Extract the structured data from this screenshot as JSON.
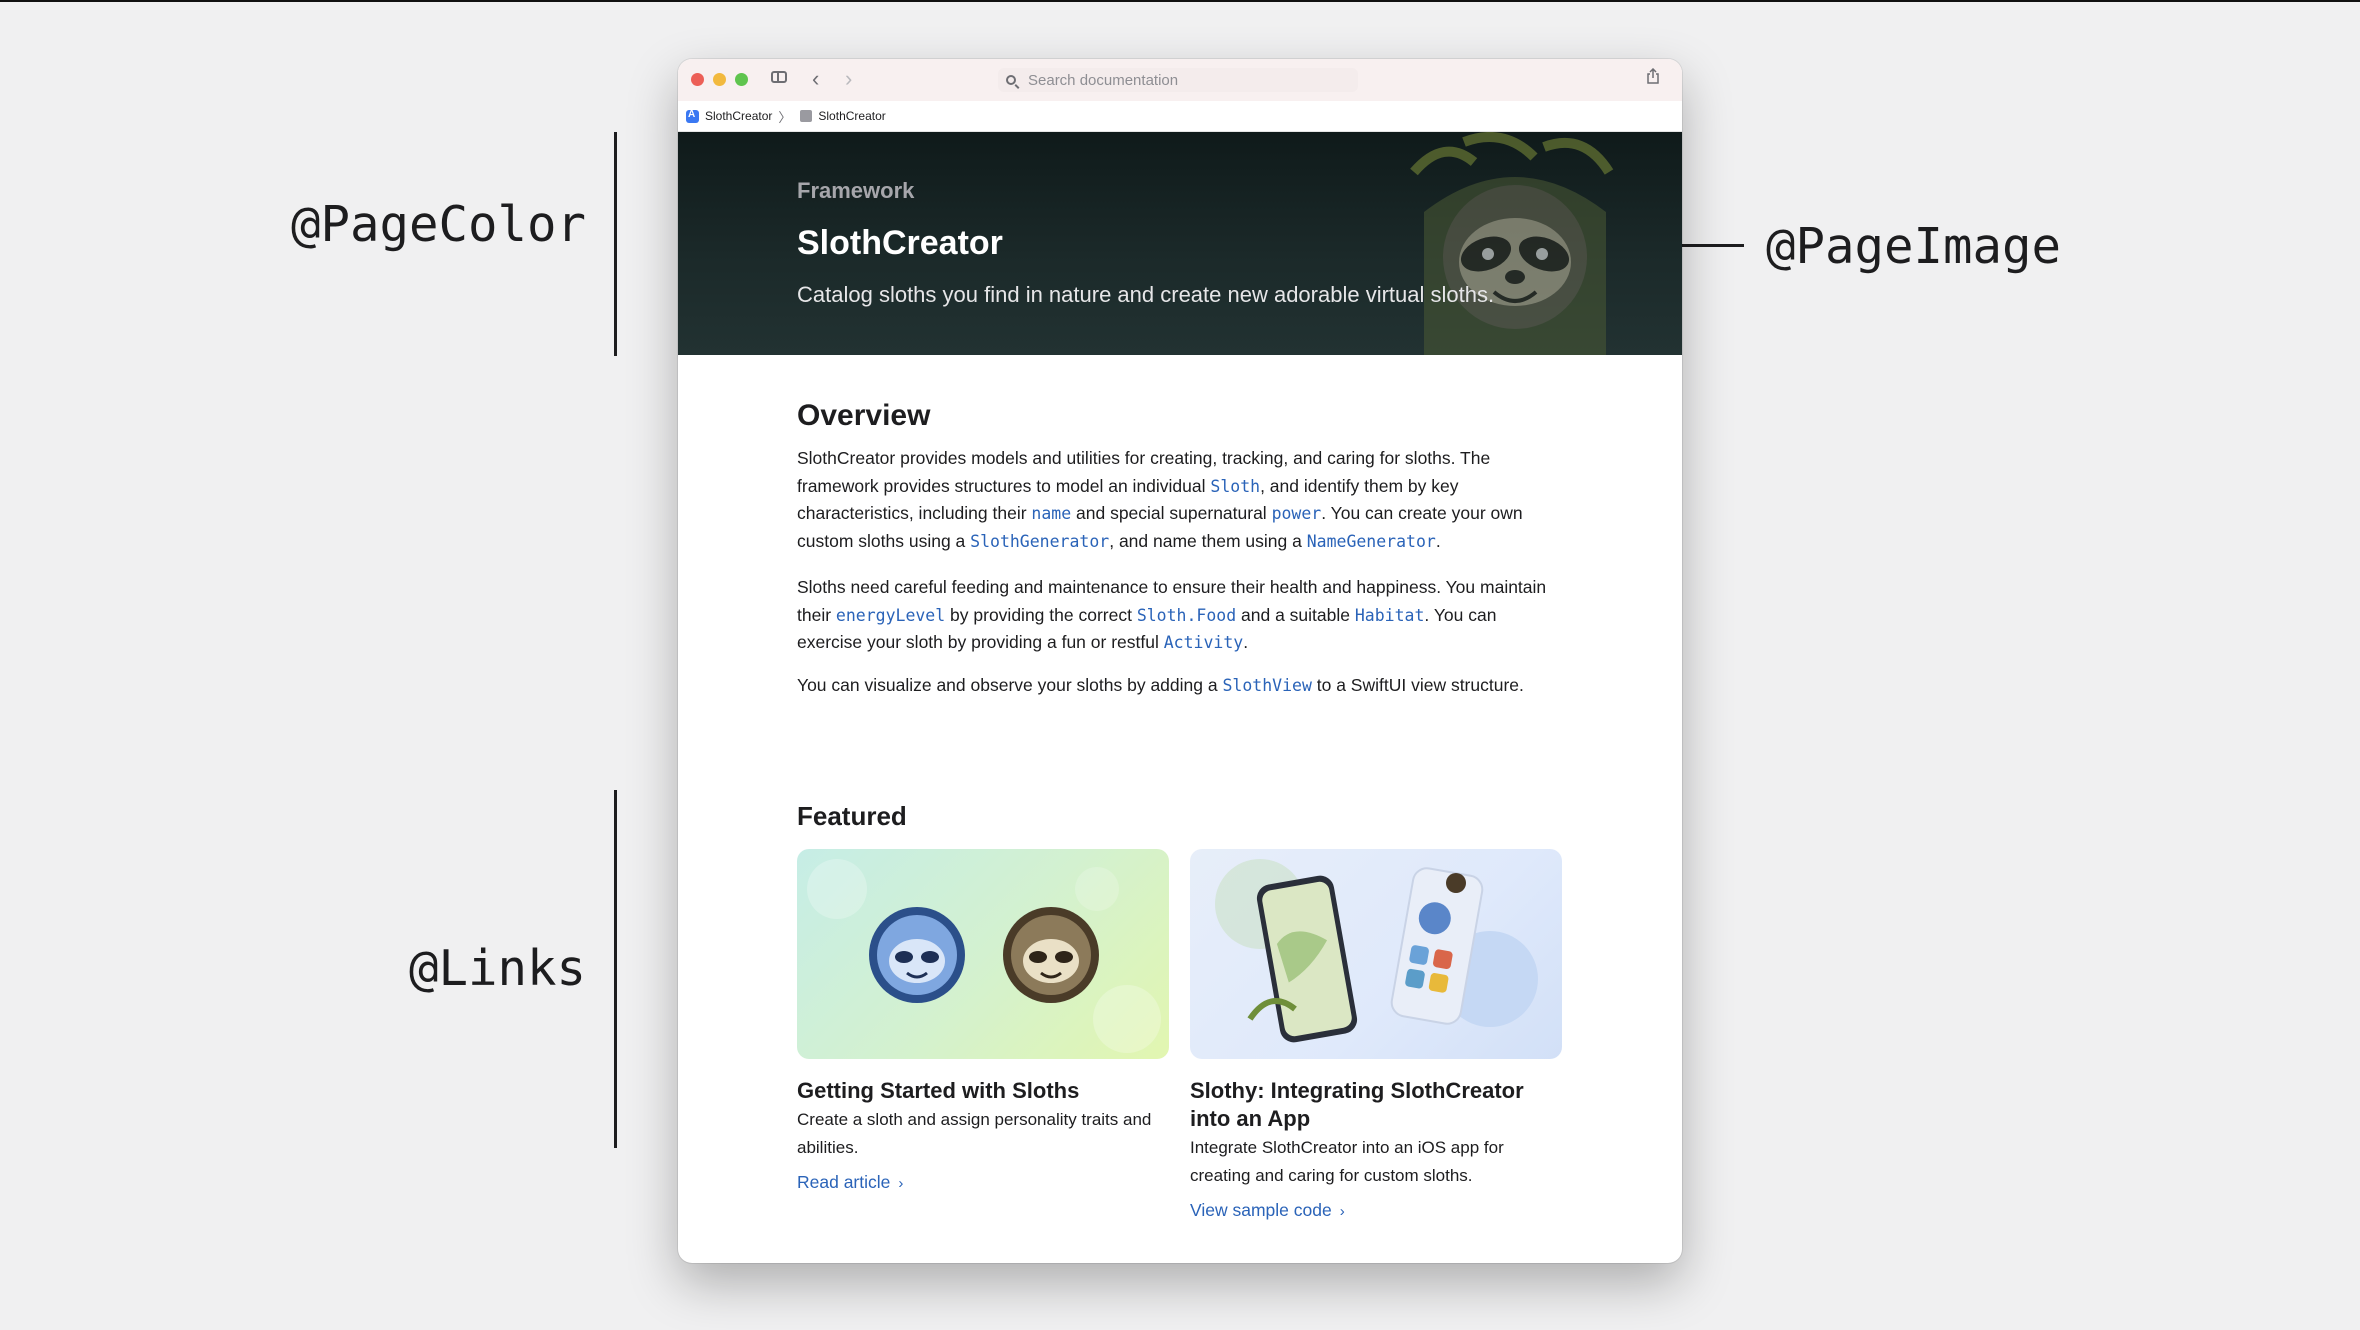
{
  "annotations": {
    "page_color": "@PageColor",
    "page_image": "@PageImage",
    "links": "@Links"
  },
  "toolbar": {
    "search_placeholder": "Search documentation"
  },
  "breadcrumb": {
    "app": "SlothCreator",
    "framework": "SlothCreator"
  },
  "hero": {
    "eyebrow": "Framework",
    "title": "SlothCreator",
    "subtitle": "Catalog sloths you find in nature and create new adorable virtual sloths.",
    "background_color": "#1b2929"
  },
  "overview": {
    "title": "Overview",
    "p1": {
      "t1": "SlothCreator provides models and utilities for creating, tracking, and caring for sloths. The framework provides structures to model an individual ",
      "s1": "Sloth",
      "t2": ", and identify them by key characteristics, including their ",
      "s2": "name",
      "t3": " and special supernatural ",
      "s3": "power",
      "t4": ". You can create your own custom sloths using a ",
      "s4": "SlothGenerator",
      "t5": ", and name them using a ",
      "s5": "NameGenerator",
      "t6": "."
    },
    "p2": {
      "t1": "Sloths need careful feeding and maintenance to ensure their health and happiness. You maintain their ",
      "s1": "energyLevel",
      "t2": " by providing the correct ",
      "s2": "Sloth.Food",
      "t3": " and a suitable ",
      "s3": "Habitat",
      "t4": ". You can exercise your sloth by providing a fun or restful ",
      "s4": "Activity",
      "t5": "."
    },
    "p3": {
      "t1": "You can visualize and observe your sloths by adding a ",
      "s1": "SlothView",
      "t2": " to a SwiftUI view structure."
    }
  },
  "featured": {
    "title": "Featured",
    "cards": [
      {
        "title": "Getting Started with Sloths",
        "description": "Create a sloth and assign personality traits and abilities.",
        "link": "Read article"
      },
      {
        "title": "Slothy: Integrating SlothCreator into an App",
        "description": "Integrate SlothCreator into an iOS app for creating and caring for custom sloths.",
        "link": "View sample code"
      }
    ]
  },
  "colors": {
    "link": "#2a63b8",
    "text": "#1d1d1f"
  }
}
